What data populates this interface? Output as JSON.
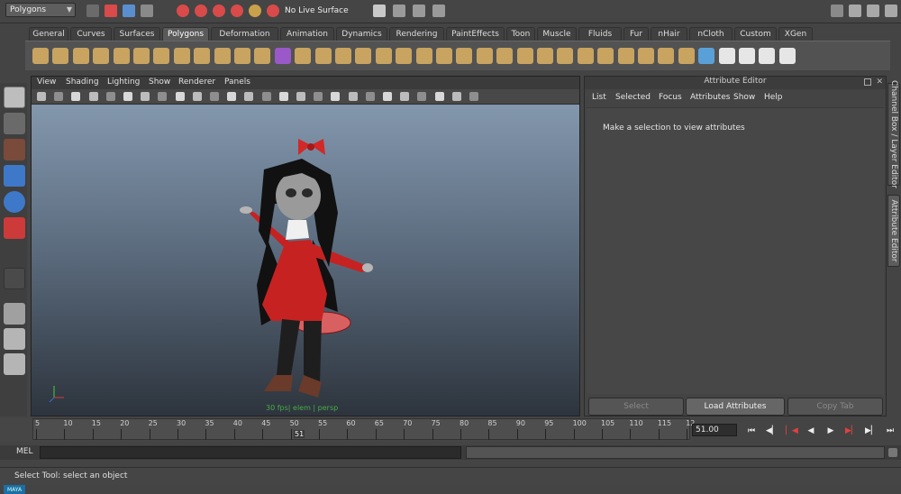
{
  "toolbar": {
    "mode": "Polygons",
    "live_surface": "No Live Surface"
  },
  "shelf": {
    "tabs": [
      "General",
      "Curves",
      "Surfaces",
      "Polygons",
      "Deformation",
      "Animation",
      "Dynamics",
      "Rendering",
      "PaintEffects",
      "Toon",
      "Muscle",
      "Fluids",
      "Fur",
      "nHair",
      "nCloth",
      "Custom",
      "XGen"
    ],
    "active": "Polygons"
  },
  "viewport": {
    "menu": [
      "View",
      "Shading",
      "Lighting",
      "Show",
      "Renderer",
      "Panels"
    ],
    "camera_label": "30 fps| elem | persp"
  },
  "attribute_editor": {
    "title": "Attribute Editor",
    "menu": [
      "List",
      "Selected",
      "Focus",
      "Attributes",
      "Show",
      "Help"
    ],
    "message": "Make a selection to view attributes",
    "buttons": {
      "select": "Select",
      "load": "Load Attributes",
      "copy": "Copy Tab"
    }
  },
  "side_tabs": {
    "channel_box": "Channel Box / Layer Editor",
    "attribute_editor": "Attribute Editor"
  },
  "timeline": {
    "ticks": [
      5,
      10,
      15,
      20,
      25,
      30,
      35,
      40,
      45,
      50,
      55,
      60,
      65,
      70,
      75,
      80,
      85,
      90,
      95,
      100,
      105,
      110,
      115,
      12
    ],
    "marker": "51",
    "current": "51.00"
  },
  "command_line": {
    "label": "MEL"
  },
  "help_line": {
    "text": "Select Tool: select an object"
  },
  "logo_text": "MAYA",
  "colors": {
    "accent": "#1b6fa6",
    "character_dress": "#c62222",
    "active_tab": "#5a5a5a"
  }
}
